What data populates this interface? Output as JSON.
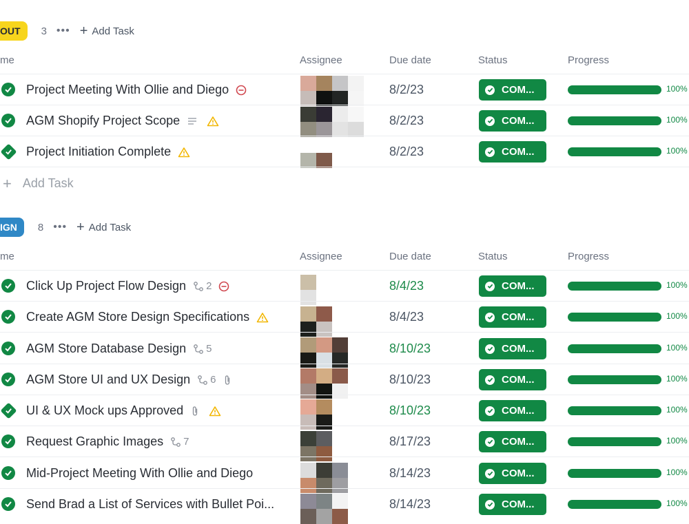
{
  "groups": [
    {
      "badge": "OUT",
      "badge_color": "#f7d51d",
      "count": "3",
      "add_label": "Add Task",
      "columns": {
        "name": "me",
        "assignee": "Assignee",
        "due": "Due date",
        "status": "Status",
        "progress": "Progress"
      },
      "add_row_label": "Add Task",
      "tasks": [
        {
          "name": "Project Meeting With Ollie and Diego",
          "check": "circle",
          "extras": [
            {
              "icon": "minus-circle-icon"
            }
          ],
          "due": "8/2/23",
          "due_green": false,
          "status": "COM...",
          "progress": "100%"
        },
        {
          "name": "AGM Shopify Project Scope",
          "check": "circle",
          "extras": [
            {
              "icon": "description-lines-icon"
            },
            {
              "icon": "warning-icon"
            }
          ],
          "due": "8/2/23",
          "due_green": false,
          "status": "COM...",
          "progress": "100%"
        },
        {
          "name": "Project Initiation Complete",
          "check": "diamond",
          "extras": [
            {
              "icon": "warning-icon"
            }
          ],
          "due": "8/2/23",
          "due_green": false,
          "status": "COM...",
          "progress": "100%"
        }
      ]
    },
    {
      "badge": "IGN",
      "badge_color": "#2f88c6",
      "count": "8",
      "add_label": "Add Task",
      "columns": {
        "name": "me",
        "assignee": "Assignee",
        "due": "Due date",
        "status": "Status",
        "progress": "Progress"
      },
      "tasks": [
        {
          "name": "Click Up Project Flow Design",
          "check": "circle",
          "extras": [
            {
              "icon": "subtask-icon",
              "text": "2"
            },
            {
              "icon": "minus-circle-icon"
            }
          ],
          "due": "8/4/23",
          "due_green": true,
          "status": "COM...",
          "progress": "100%"
        },
        {
          "name": "Create AGM Store Design Specifications",
          "check": "circle",
          "extras": [
            {
              "icon": "warning-icon"
            }
          ],
          "due": "8/4/23",
          "due_green": false,
          "status": "COM...",
          "progress": "100%"
        },
        {
          "name": "AGM Store Database Design",
          "check": "circle",
          "extras": [
            {
              "icon": "subtask-icon",
              "text": "5"
            }
          ],
          "due": "8/10/23",
          "due_green": true,
          "status": "COM...",
          "progress": "100%"
        },
        {
          "name": "AGM Store UI and UX Design",
          "check": "circle",
          "extras": [
            {
              "icon": "subtask-icon",
              "text": "6"
            },
            {
              "icon": "paperclip-icon"
            }
          ],
          "due": "8/10/23",
          "due_green": false,
          "status": "COM...",
          "progress": "100%"
        },
        {
          "name": "UI & UX Mock ups Approved",
          "check": "diamond",
          "extras": [
            {
              "icon": "paperclip-icon"
            },
            {
              "icon": "warning-icon"
            }
          ],
          "due": "8/10/23",
          "due_green": true,
          "status": "COM...",
          "progress": "100%"
        },
        {
          "name": "Request Graphic Images",
          "check": "circle",
          "extras": [
            {
              "icon": "subtask-icon",
              "text": "7"
            }
          ],
          "due": "8/17/23",
          "due_green": false,
          "status": "COM...",
          "progress": "100%"
        },
        {
          "name": "Mid-Project Meeting With Ollie and Diego",
          "check": "circle",
          "extras": [],
          "due": "8/14/23",
          "due_green": false,
          "status": "COM...",
          "progress": "100%"
        },
        {
          "name": "Send Brad a List of Services with Bullet Poi...",
          "check": "circle",
          "extras": [],
          "due": "8/14/23",
          "due_green": false,
          "status": "COM...",
          "progress": "100%"
        }
      ]
    }
  ],
  "colors": {
    "complete": "#118844",
    "due_green": "#1d8a4a",
    "warning": "#f2b600",
    "blocked": "#d0474f"
  }
}
